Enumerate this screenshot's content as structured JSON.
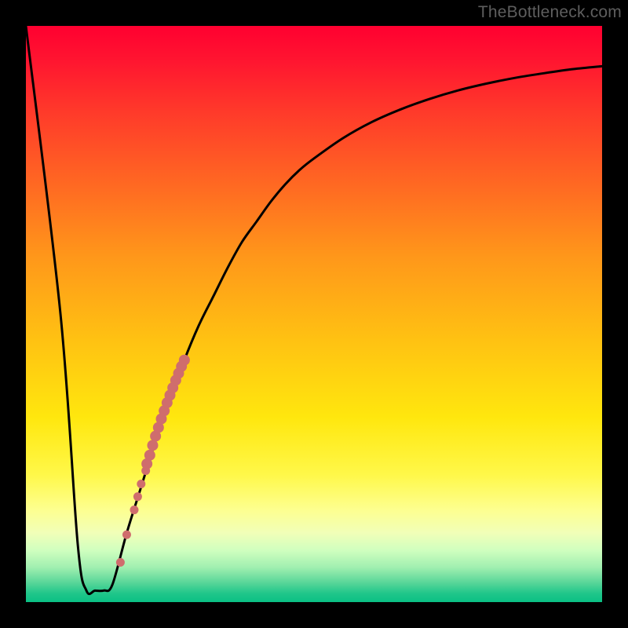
{
  "watermark": "TheBottleneck.com",
  "colors": {
    "frame": "#000000",
    "curve": "#000000",
    "dot_fill": "#cf6d6d",
    "gradient_top": "#ff0030",
    "gradient_bottom": "#0ac084"
  },
  "chart_data": {
    "type": "line",
    "title": "",
    "xlabel": "",
    "ylabel": "",
    "xlim": [
      0,
      100
    ],
    "ylim": [
      0,
      100
    ],
    "series": [
      {
        "name": "bottleneck-curve",
        "x": [
          0,
          6,
          9,
          10.5,
          12,
          13.5,
          15,
          17.5,
          20,
          22.5,
          25,
          27.5,
          30,
          32.5,
          35,
          37.5,
          40,
          42.5,
          45,
          47.5,
          50,
          55,
          60,
          65,
          70,
          75,
          80,
          85,
          90,
          95,
          100
        ],
        "y": [
          100,
          50,
          10,
          2,
          2,
          2,
          3,
          12,
          20,
          28,
          35,
          42,
          48,
          53,
          58,
          62.5,
          66,
          69.5,
          72.5,
          75,
          77,
          80.5,
          83.3,
          85.5,
          87.3,
          88.8,
          90,
          91,
          91.8,
          92.5,
          93
        ]
      }
    ],
    "scatter": {
      "name": "highlight-dots",
      "points": [
        {
          "x": 16.4,
          "y": 6.9,
          "r": 5.5
        },
        {
          "x": 17.5,
          "y": 11.7,
          "r": 5.5
        },
        {
          "x": 18.8,
          "y": 16.0,
          "r": 5.5
        },
        {
          "x": 19.4,
          "y": 18.3,
          "r": 5.5
        },
        {
          "x": 20.0,
          "y": 20.5,
          "r": 5.5
        },
        {
          "x": 20.8,
          "y": 22.8,
          "r": 5.5
        },
        {
          "x": 21.0,
          "y": 24.0,
          "r": 7.0
        },
        {
          "x": 21.5,
          "y": 25.5,
          "r": 7.0
        },
        {
          "x": 22.0,
          "y": 27.2,
          "r": 7.0
        },
        {
          "x": 22.5,
          "y": 28.8,
          "r": 7.0
        },
        {
          "x": 23.0,
          "y": 30.3,
          "r": 7.0
        },
        {
          "x": 23.5,
          "y": 31.8,
          "r": 7.0
        },
        {
          "x": 24.0,
          "y": 33.2,
          "r": 7.0
        },
        {
          "x": 24.5,
          "y": 34.6,
          "r": 7.0
        },
        {
          "x": 25.0,
          "y": 35.9,
          "r": 7.0
        },
        {
          "x": 25.5,
          "y": 37.2,
          "r": 7.0
        },
        {
          "x": 26.0,
          "y": 38.5,
          "r": 7.0
        },
        {
          "x": 26.5,
          "y": 39.7,
          "r": 7.0
        },
        {
          "x": 27.0,
          "y": 40.9,
          "r": 7.0
        },
        {
          "x": 27.5,
          "y": 42.0,
          "r": 7.0
        }
      ]
    }
  }
}
